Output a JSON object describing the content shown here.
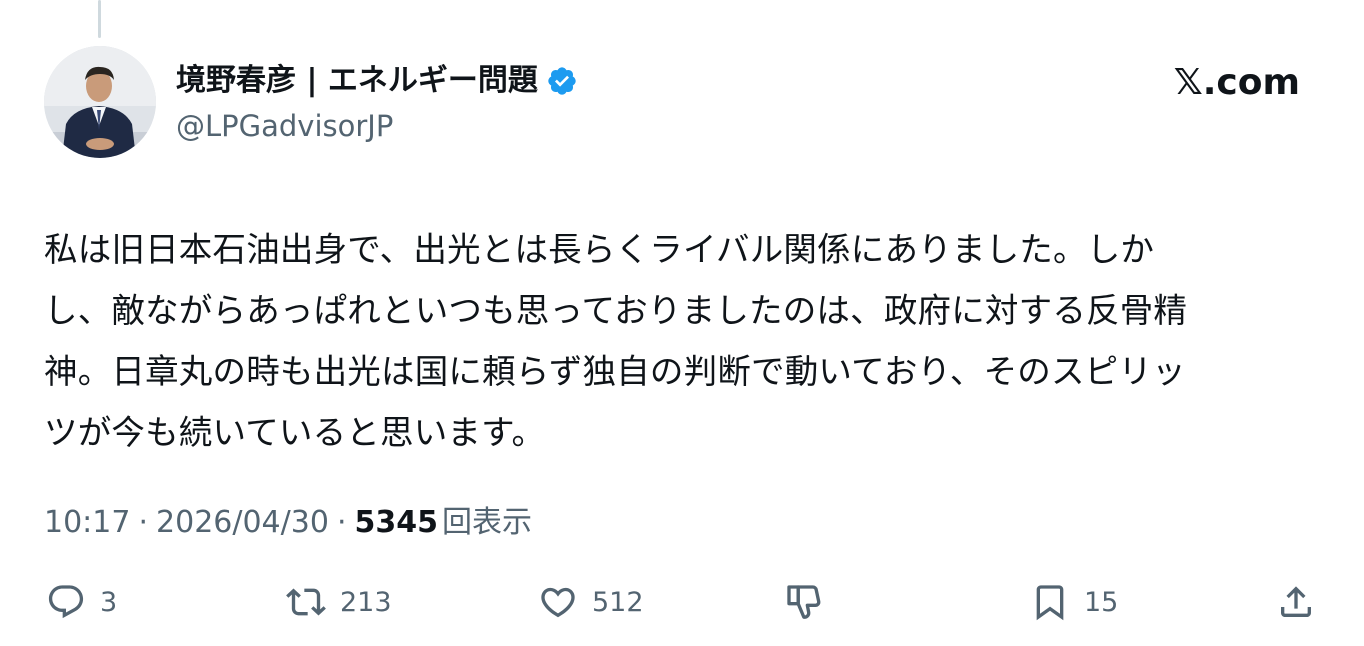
{
  "author": {
    "display_name": "境野春彦 | エネルギー問題",
    "handle": "@LPGadvisorJP",
    "verified": true,
    "verified_color": "#1d9bf0"
  },
  "brand": {
    "logo_text": "𝕏.com"
  },
  "tweet": {
    "lines": [
      "私は旧日本石油出身で、出光とは長らくライバル関係にありました。しか",
      "し、敵ながらあっぱれといつも思っておりましたのは、政府に対する反骨精",
      "神。日章丸の時も出光は国に頼らず独自の判断で動いており、そのスピリッ",
      "ツが今も続いていると思います。"
    ]
  },
  "meta": {
    "time": "10:17",
    "separator": "·",
    "date": "2026/04/30",
    "views_count": "5345",
    "views_label": "回表示"
  },
  "actions": {
    "replies": "3",
    "reposts": "213",
    "likes": "512",
    "bookmarks": "15"
  },
  "icons": {
    "reply": "reply-icon",
    "repost": "repost-icon",
    "like": "heart-icon",
    "dislike": "dislike-icon",
    "bookmark": "bookmark-icon",
    "share": "share-icon"
  },
  "colors": {
    "text_primary": "#0f1419",
    "text_secondary": "#536471",
    "background": "#ffffff"
  }
}
